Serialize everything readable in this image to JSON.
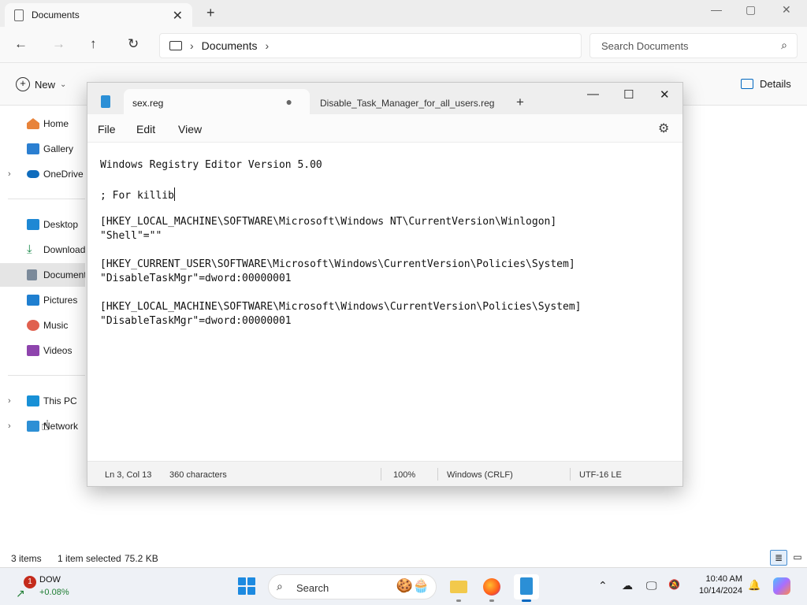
{
  "explorer": {
    "tab_title": "Documents",
    "tab_close": "✕",
    "new_tab": "+",
    "window_controls": {
      "minimize": "—",
      "maximize": "▢",
      "close": "✕"
    },
    "nav": {
      "back": "←",
      "forward": "→",
      "up": "↑",
      "refresh": "↻"
    },
    "breadcrumb": {
      "crumb": "Documents",
      "sep1": "›",
      "sep2": "›"
    },
    "search_placeholder": "Search Documents",
    "command_bar": {
      "new_label": "New",
      "new_chevron": "⌄",
      "details_label": "Details"
    },
    "sidebar": {
      "items": [
        {
          "label": "Home"
        },
        {
          "label": "Gallery"
        },
        {
          "label": "OneDrive",
          "chevron": "›"
        },
        {
          "label": "Desktop"
        },
        {
          "label": "Downloads"
        },
        {
          "label": "Documents"
        },
        {
          "label": "Pictures"
        },
        {
          "label": "Music"
        },
        {
          "label": "Videos"
        },
        {
          "label": "This PC",
          "chevron": "›"
        },
        {
          "label": "Network",
          "chevron": "›"
        }
      ]
    },
    "status": {
      "items": "3 items",
      "selected": "1 item selected",
      "size": "75.2 KB"
    }
  },
  "notepad": {
    "active_tab": "sex.reg",
    "unsaved_dot": "●",
    "other_tab": "Disable_Task_Manager_for_all_users.reg",
    "new_tab": "+",
    "window_controls": {
      "minimize": "—",
      "maximize": "☐",
      "close": "✕"
    },
    "menu": {
      "file": "File",
      "edit": "Edit",
      "view": "View",
      "settings_icon": "⚙"
    },
    "lines": [
      "Windows Registry Editor Version 5.00",
      "; For killib",
      "[HKEY_LOCAL_MACHINE\\SOFTWARE\\Microsoft\\Windows NT\\CurrentVersion\\Winlogon]",
      "\"Shell\"=\"\"",
      "[HKEY_CURRENT_USER\\SOFTWARE\\Microsoft\\Windows\\CurrentVersion\\Policies\\System]",
      "\"DisableTaskMgr\"=dword:00000001",
      "[HKEY_LOCAL_MACHINE\\SOFTWARE\\Microsoft\\Windows\\CurrentVersion\\Policies\\System]",
      "\"DisableTaskMgr\"=dword:00000001"
    ],
    "status": {
      "position": "Ln 3, Col 13",
      "characters": "360 characters",
      "zoom": "100%",
      "line_ending": "Windows (CRLF)",
      "encoding": "UTF-16 LE"
    }
  },
  "taskbar": {
    "widget": {
      "badge": "1",
      "name": "DOW",
      "value": "+0.08%"
    },
    "search_label": "Search",
    "search_deco": "🍪🧁",
    "clock": {
      "time": "10:40 AM",
      "date": "10/14/2024"
    },
    "tray": {
      "chevron": "⌃",
      "icon1": "☁",
      "icon2": "🖵",
      "icon3": "🔕",
      "bell": "🔔"
    }
  },
  "colors": {
    "accent": "#0067c0",
    "notepad_blue": "#2b8fd6"
  }
}
